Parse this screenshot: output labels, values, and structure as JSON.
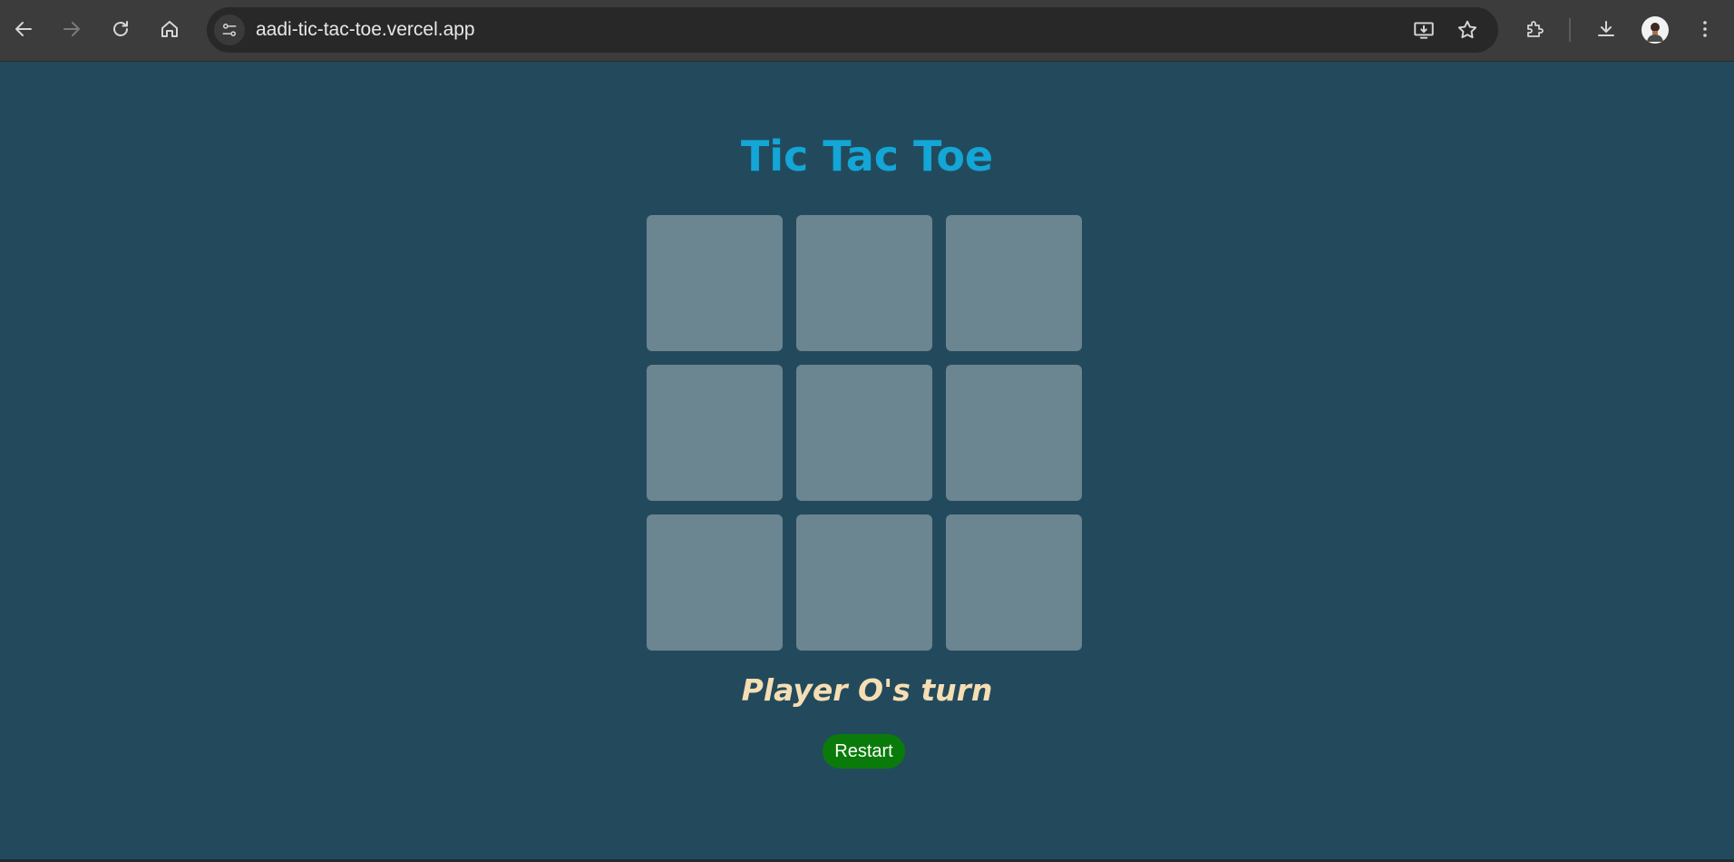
{
  "browser": {
    "url": "aadi-tic-tac-toe.vercel.app",
    "icons": {
      "back": "back-arrow-icon",
      "forward": "forward-arrow-icon",
      "reload": "reload-icon",
      "home": "home-icon",
      "site_info": "tune-icon",
      "install": "install-app-icon",
      "bookmark": "star-icon",
      "extensions": "puzzle-icon",
      "downloads": "download-icon",
      "menu": "kebab-menu-icon"
    }
  },
  "game": {
    "title": "Tic Tac Toe",
    "status": "Player O's turn",
    "restart_label": "Restart",
    "board": [
      "",
      "",
      "",
      "",
      "",
      "",
      "",
      "",
      ""
    ]
  },
  "colors": {
    "background": "#234a5c",
    "title": "#13a6d6",
    "cell": "#6b8591",
    "status": "#f6deb4",
    "restart": "#0a7b0a"
  }
}
